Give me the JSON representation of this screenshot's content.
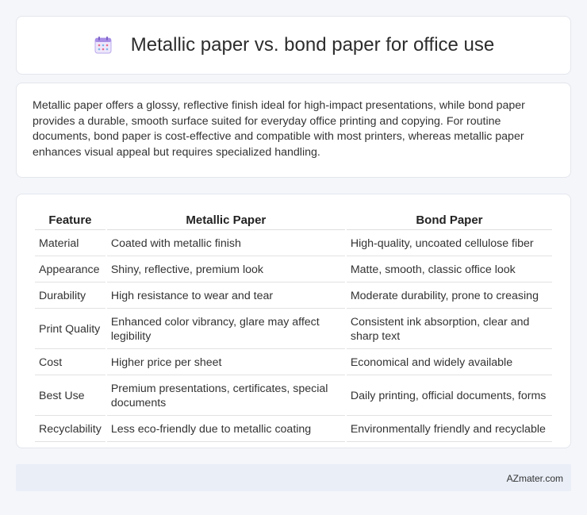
{
  "header": {
    "icon": "calendar-icon",
    "title": "Metallic paper vs. bond paper for office use"
  },
  "summary": {
    "text": "Metallic paper offers a glossy, reflective finish ideal for high-impact presentations, while bond paper provides a durable, smooth surface suited for everyday office printing and copying. For routine documents, bond paper is cost-effective and compatible with most printers, whereas metallic paper enhances visual appeal but requires specialized handling."
  },
  "table": {
    "headers": [
      "Feature",
      "Metallic Paper",
      "Bond Paper"
    ],
    "rows": [
      [
        "Material",
        "Coated with metallic finish",
        "High-quality, uncoated cellulose fiber"
      ],
      [
        "Appearance",
        "Shiny, reflective, premium look",
        "Matte, smooth, classic office look"
      ],
      [
        "Durability",
        "High resistance to wear and tear",
        "Moderate durability, prone to creasing"
      ],
      [
        "Print Quality",
        "Enhanced color vibrancy, glare may affect legibility",
        "Consistent ink absorption, clear and sharp text"
      ],
      [
        "Cost",
        "Higher price per sheet",
        "Economical and widely available"
      ],
      [
        "Best Use",
        "Premium presentations, certificates, special documents",
        "Daily printing, official documents, forms"
      ],
      [
        "Recyclability",
        "Less eco-friendly due to metallic coating",
        "Environmentally friendly and recyclable"
      ]
    ]
  },
  "footer": {
    "text": "AZmater.com"
  }
}
